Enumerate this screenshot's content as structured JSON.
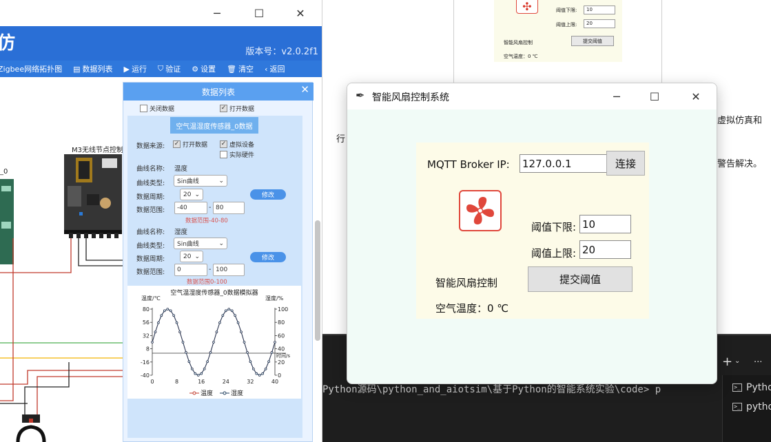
{
  "sim": {
    "version_label": "版本号：v2.0.2f1",
    "toolbar": {
      "topology": "Zigbee网络拓扑图",
      "data_list": "数据列表",
      "run": "运行",
      "verify": "验证",
      "settings": "设置",
      "clear": "清空",
      "back": "返回"
    },
    "node_label": "M3无线节点控制",
    "node_short": "_0"
  },
  "panel": {
    "title": "数据列表",
    "close_data": "关闭数据",
    "open_data": "打开数据",
    "section_title": "空气温湿度传感器_0数据",
    "source_label": "数据来源:",
    "open_data2": "打开数据",
    "virtual_device": "虚拟设备",
    "real_hardware": "实际硬件",
    "curve1": {
      "name_label": "曲线名称:",
      "name": "温度",
      "type_label": "曲线类型:",
      "type": "Sin曲线",
      "period_label": "数据周期:",
      "period": "20",
      "range_label": "数据范围:",
      "min": "-40",
      "dash": "-",
      "max": "80",
      "hint": "数据范围-40-80",
      "modify": "修改"
    },
    "curve2": {
      "name_label": "曲线名称:",
      "name": "湿度",
      "type_label": "曲线类型:",
      "type": "Sin曲线",
      "period_label": "数据周期:",
      "period": "20",
      "range_label": "数据范围:",
      "min": "0",
      "dash": "-",
      "max": "100",
      "hint": "数据范围0-100",
      "modify": "修改"
    }
  },
  "chart_data": {
    "type": "line",
    "title": "空气温湿度传感器_0数据模拟器",
    "ylabel_left": "温度/℃",
    "ylabel_right": "湿度/%",
    "xlabel": "时间/s",
    "xlim": [
      0,
      40
    ],
    "x_ticks": [
      "0",
      "8",
      "16",
      "24",
      "32",
      "40"
    ],
    "y_left_ticks": [
      "80",
      "56",
      "32",
      "8",
      "-16",
      "-40"
    ],
    "y_right_ticks": [
      "100",
      "80",
      "60",
      "40",
      "20",
      "0"
    ],
    "ylim_left": [
      -40,
      80
    ],
    "ylim_right": [
      0,
      100
    ],
    "legend": [
      "温度",
      "湿度"
    ],
    "series": [
      {
        "name": "温度",
        "color": "#c0392b",
        "values": [
          20,
          38.5,
          55.3,
          68.5,
          77.1,
          80,
          77.1,
          68.5,
          55.3,
          38.5,
          20,
          1.5,
          -15.3,
          -28.5,
          -37.1,
          -40,
          -37.1,
          -28.5,
          -15.3,
          1.5,
          20,
          38.5,
          55.3,
          68.5,
          77.1,
          80,
          77.1,
          68.5,
          55.3,
          38.5,
          20,
          1.5,
          -15.3,
          -28.5,
          -37.1,
          -40,
          -37.1,
          -28.5,
          -15.3,
          1.5,
          20
        ]
      },
      {
        "name": "湿度",
        "color": "#1f3f5f",
        "values": [
          50,
          65.5,
          79.4,
          90.5,
          97.6,
          100,
          97.6,
          90.5,
          79.4,
          65.5,
          50,
          34.5,
          20.6,
          9.5,
          2.4,
          0,
          2.4,
          9.5,
          20.6,
          34.5,
          50,
          65.5,
          79.4,
          90.5,
          97.6,
          100,
          97.6,
          90.5,
          79.4,
          65.5,
          50,
          34.5,
          20.6,
          9.5,
          2.4,
          0,
          2.4,
          9.5,
          20.6,
          34.5,
          50
        ]
      }
    ]
  },
  "bgwin": {
    "low_label": "阈值下限:",
    "low_value": "10",
    "high_label": "阈值上限:",
    "high_value": "20",
    "fan_label": "智能风扇控制",
    "submit": "提交阈值",
    "temp": "空气温度：0 ℃"
  },
  "doc": {
    "line1_right": "虚拟仿真和",
    "line1_left": "行",
    "line2_right": "警告解决。"
  },
  "terminal": {
    "command": "Python源码\\python_and_aiotsim\\基于Python的智能系统实验\\code> p",
    "plus": "+",
    "dots": "···",
    "items": [
      "Pytho",
      "pytho"
    ]
  },
  "fan": {
    "title": "智能风扇控制系统",
    "broker_label": "MQTT Broker IP:",
    "broker_value": "127.0.0.1",
    "connect": "连接",
    "low_label": "阈值下限:",
    "low_value": "10",
    "high_label": "阈值上限:",
    "high_value": "20",
    "fan_label": "智能风扇控制",
    "submit": "提交阈值",
    "temp": "空气温度：0 ℃"
  }
}
